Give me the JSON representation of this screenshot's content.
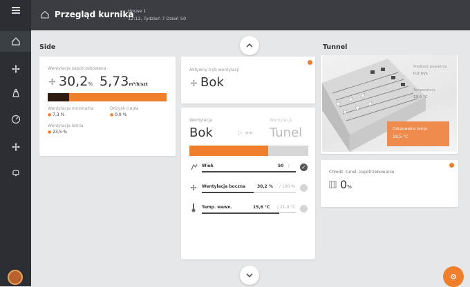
{
  "header": {
    "title": "Przegląd kurnika",
    "house": "House 1",
    "datetime": "12:12, Tydzień 7 Dzień 50"
  },
  "sections": {
    "side": "Side",
    "tunnel": "Tunnel"
  },
  "side_card": {
    "label": "Wentylacja zapotrzebowana",
    "percent_value": "30,2",
    "percent_unit": "%",
    "flow_value": "5,73",
    "flow_unit": "m³/h/szt",
    "progress_dark": 0.18,
    "stat1_label": "Wentylacja minimalna",
    "stat1_value": "7,3 %",
    "stat2_label": "Odzysk ciepła",
    "stat2_value": "0,0 %",
    "stat3_label": "Wentylacja letnia",
    "stat3_value": "23,5 %"
  },
  "mode_card": {
    "label": "Aktywny tryb wentylacji",
    "value": "Bok"
  },
  "vent_card": {
    "left_label": "Wentylacja",
    "left_value": "Bok",
    "right_label": "Wentylacja",
    "right_value": "Tunel",
    "progress": 0.66,
    "rows": [
      {
        "label": "Wiek",
        "value": "50",
        "unit": "/",
        "check": true
      },
      {
        "label": "Wentylacja boczna",
        "value": "30,2 %",
        "unit": "/ 100 %",
        "check": false
      },
      {
        "label": "Temp. wewn.",
        "value": "19,6 °C",
        "unit": "/ 21,0 °C",
        "check": false
      }
    ]
  },
  "tunnel_card": {
    "img_label1": "Prędkość powietrza",
    "img_value1": "0,0 m/s",
    "img_label2": "Temperatura",
    "img_value2": "19,6 °C",
    "box_label": "Odczuwalna temp.",
    "box_value": "19,5 °C"
  },
  "cooling_card": {
    "label": "Chłodz. tunel. zapotrzebowanie",
    "value": "0",
    "unit": "%"
  },
  "colors": {
    "accent": "#ef7f2c",
    "dark": "#2b2f33"
  },
  "icons": [
    "menu-icon",
    "home-icon",
    "fan-icon",
    "weight-icon",
    "gauge-icon",
    "fan-alt-icon",
    "bell-icon"
  ]
}
